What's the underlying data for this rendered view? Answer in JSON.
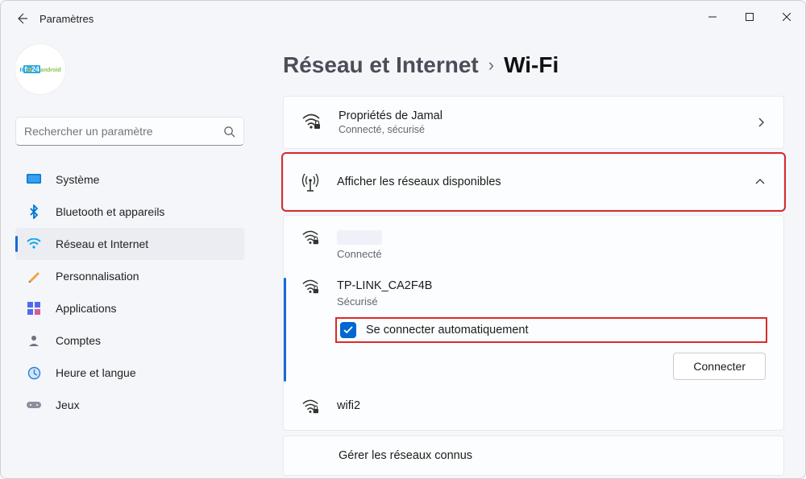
{
  "window": {
    "title": "Paramètres"
  },
  "search": {
    "placeholder": "Rechercher un paramètre"
  },
  "sidebar": {
    "items": [
      {
        "label": "Système"
      },
      {
        "label": "Bluetooth et appareils"
      },
      {
        "label": "Réseau et Internet"
      },
      {
        "label": "Personnalisation"
      },
      {
        "label": "Applications"
      },
      {
        "label": "Comptes"
      },
      {
        "label": "Heure et langue"
      },
      {
        "label": "Jeux"
      }
    ]
  },
  "breadcrumb": {
    "parent": "Réseau et Internet",
    "current": "Wi-Fi"
  },
  "properties_card": {
    "title": "Propriétés de Jamal",
    "subtitle": "Connecté, sécurisé"
  },
  "available_card": {
    "title": "Afficher les réseaux disponibles"
  },
  "networks": {
    "n0": {
      "name": "",
      "status": "Connecté"
    },
    "n1": {
      "name": "TP-LINK_CA2F4B",
      "status": "Sécurisé",
      "auto_label": "Se connecter automatiquement",
      "connect_label": "Connecter"
    },
    "n2": {
      "name": "wifi2"
    }
  },
  "known_card": {
    "title": "Gérer les réseaux connus"
  }
}
